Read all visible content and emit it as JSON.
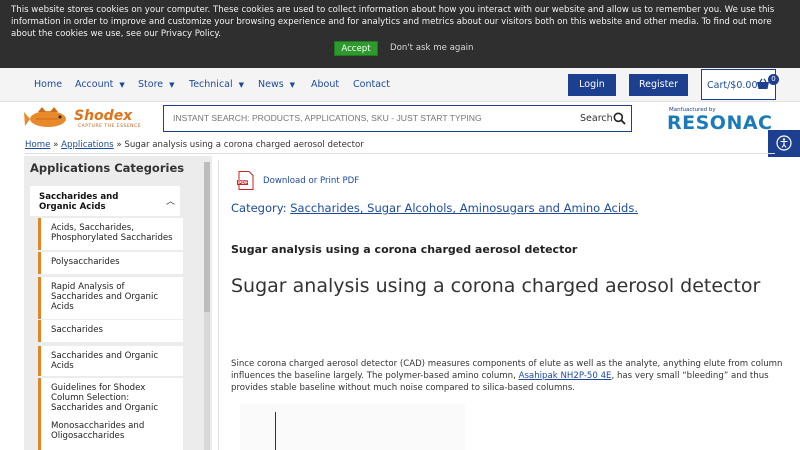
{
  "cookie": {
    "text": "This website stores cookies on your computer. These cookies are used to collect information about how you interact with our website and allow us to remember you. We use this information in order to improve and customize your browsing experience and for analytics and metrics about our visitors both on this website and other media. To find out more about the cookies we use, see our Privacy Policy.",
    "accept": "Accept",
    "deny": "Don't ask me again"
  },
  "nav": {
    "home": "Home",
    "account": "Account",
    "store": "Store",
    "technical": "Technical",
    "news": "News",
    "about": "About",
    "contact": "Contact",
    "login": "Login",
    "register": "Register",
    "cart": "Cart/$0.00",
    "cart_count": "0"
  },
  "logo": {
    "name": "Shodex",
    "tagline": "CAPTURE THE ESSENCE",
    "manufactured_by": "Manfuactured by",
    "resonac": "RESONAC"
  },
  "search": {
    "placeholder": "INSTANT SEARCH: PRODUCTS, APPLICATIONS, SKU - JUST START TYPING",
    "label": "Search"
  },
  "breadcrumb": {
    "home": "Home",
    "applications": "Applications",
    "sep": "»",
    "current": "Sugar analysis using a corona charged aerosol detector"
  },
  "sidebar": {
    "title": "Applications Categories",
    "group": "Saccharides and Organic Acids",
    "items": [
      "Acids, Saccharides, Phosphorylated Saccharides",
      "Polysaccharides",
      "Rapid Analysis of Saccharides and Organic Acids",
      "Saccharides",
      "Saccharides and Organic Acids",
      "Guidelines for Shodex Column Selection: Saccharides and Organic",
      "Monosaccharides and Oligosaccharides"
    ]
  },
  "main": {
    "pdf_link": "Download or Print PDF",
    "category_label": "Category:",
    "category_value": "Saccharides, Sugar Alcohols, Aminosugars and Amino Acids.",
    "subtitle": "Sugar analysis using a corona charged aerosol detector",
    "title": "Sugar analysis using a corona charged aerosol detector",
    "para_1": "Since corona charged aerosol detector (CAD) measures components of elute as well as the analyte, anything elute from column influences the baseline largely. The polymer-based amino column, ",
    "para_link": "Asahipak NH2P-50 4E",
    "para_2": ", has very small “bleeding” and thus provides stable baseline without much noise compared to silica-based columns."
  },
  "colors": {
    "brand_blue": "#1d3f8f",
    "link_blue": "#1d4a9c",
    "accent_orange": "#e2852a",
    "accept_green": "#2e9a2e"
  }
}
